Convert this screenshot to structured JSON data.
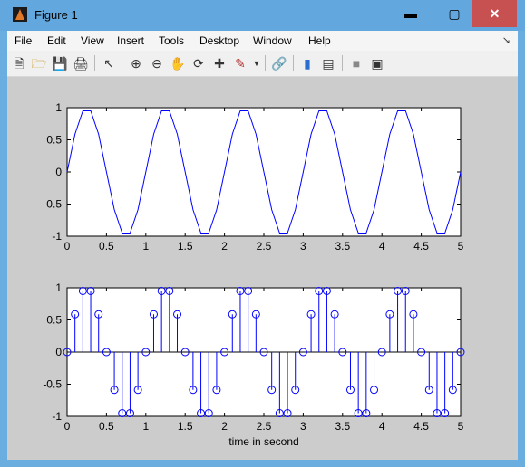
{
  "window": {
    "title": "Figure 1"
  },
  "menu": [
    "File",
    "Edit",
    "View",
    "Insert",
    "Tools",
    "Desktop",
    "Window",
    "Help"
  ],
  "toolbar": [
    "new-figure-icon",
    "open-file-icon",
    "save-icon",
    "print-icon",
    "edit-plot-icon",
    "zoom-in-icon",
    "zoom-out-icon",
    "pan-icon",
    "rotate-3d-icon",
    "data-cursor-icon",
    "brush-icon",
    "link-plot-icon",
    "colorbar-icon",
    "legend-icon",
    "hide-plot-tools-icon",
    "show-plot-tools-icon"
  ],
  "colors": {
    "figure_bg": "#cccccc",
    "series": "#0000ff",
    "close_button": "#c75050"
  },
  "chart_data": [
    {
      "type": "line",
      "title": "",
      "xlabel": "",
      "ylabel": "",
      "xlim": [
        0,
        5
      ],
      "ylim": [
        -1,
        1
      ],
      "xticks": [
        "0",
        "0.5",
        "1",
        "1.5",
        "2",
        "2.5",
        "3",
        "3.5",
        "4",
        "4.5",
        "5"
      ],
      "yticks": [
        "1",
        "0.5",
        "0",
        "-0.5",
        "-1"
      ],
      "series": [
        {
          "x": [
            0,
            0.1,
            0.2,
            0.3,
            0.4,
            0.5,
            0.6,
            0.7,
            0.8,
            0.9,
            1.0,
            1.1,
            1.2,
            1.3,
            1.4,
            1.5,
            1.6,
            1.7,
            1.8,
            1.9,
            2.0,
            2.1,
            2.2,
            2.3,
            2.4,
            2.5,
            2.6,
            2.7,
            2.8,
            2.9,
            3.0,
            3.1,
            3.2,
            3.3,
            3.4,
            3.5,
            3.6,
            3.7,
            3.8,
            3.9,
            4.0,
            4.1,
            4.2,
            4.3,
            4.4,
            4.5,
            4.6,
            4.7,
            4.8,
            4.9,
            5.0
          ],
          "y": [
            0,
            0.588,
            0.951,
            0.951,
            0.588,
            0,
            -0.588,
            -0.951,
            -0.951,
            -0.588,
            0,
            0.588,
            0.951,
            0.951,
            0.588,
            0,
            -0.588,
            -0.951,
            -0.951,
            -0.588,
            0,
            0.588,
            0.951,
            0.951,
            0.588,
            0,
            -0.588,
            -0.951,
            -0.951,
            -0.588,
            0,
            0.588,
            0.951,
            0.951,
            0.588,
            0,
            -0.588,
            -0.951,
            -0.951,
            -0.588,
            0,
            0.588,
            0.951,
            0.951,
            0.588,
            0,
            -0.588,
            -0.951,
            -0.951,
            -0.588,
            0
          ]
        }
      ],
      "grid": false
    },
    {
      "type": "stem",
      "title": "",
      "xlabel": "time in second",
      "ylabel": "",
      "xlim": [
        0,
        5
      ],
      "ylim": [
        -1,
        1
      ],
      "xticks": [
        "0",
        "0.5",
        "1",
        "1.5",
        "2",
        "2.5",
        "3",
        "3.5",
        "4",
        "4.5",
        "5"
      ],
      "yticks": [
        "1",
        "0.5",
        "0",
        "-0.5",
        "-1"
      ],
      "series": [
        {
          "x": [
            0,
            0.1,
            0.2,
            0.3,
            0.4,
            0.5,
            0.6,
            0.7,
            0.8,
            0.9,
            1.0,
            1.1,
            1.2,
            1.3,
            1.4,
            1.5,
            1.6,
            1.7,
            1.8,
            1.9,
            2.0,
            2.1,
            2.2,
            2.3,
            2.4,
            2.5,
            2.6,
            2.7,
            2.8,
            2.9,
            3.0,
            3.1,
            3.2,
            3.3,
            3.4,
            3.5,
            3.6,
            3.7,
            3.8,
            3.9,
            4.0,
            4.1,
            4.2,
            4.3,
            4.4,
            4.5,
            4.6,
            4.7,
            4.8,
            4.9,
            5.0
          ],
          "y": [
            0,
            0.588,
            0.951,
            0.951,
            0.588,
            0,
            -0.588,
            -0.951,
            -0.951,
            -0.588,
            0,
            0.588,
            0.951,
            0.951,
            0.588,
            0,
            -0.588,
            -0.951,
            -0.951,
            -0.588,
            0,
            0.588,
            0.951,
            0.951,
            0.588,
            0,
            -0.588,
            -0.951,
            -0.951,
            -0.588,
            0,
            0.588,
            0.951,
            0.951,
            0.588,
            0,
            -0.588,
            -0.951,
            -0.951,
            -0.588,
            0,
            0.588,
            0.951,
            0.951,
            0.588,
            0,
            -0.588,
            -0.951,
            -0.951,
            -0.588,
            0
          ]
        }
      ],
      "grid": false
    }
  ]
}
